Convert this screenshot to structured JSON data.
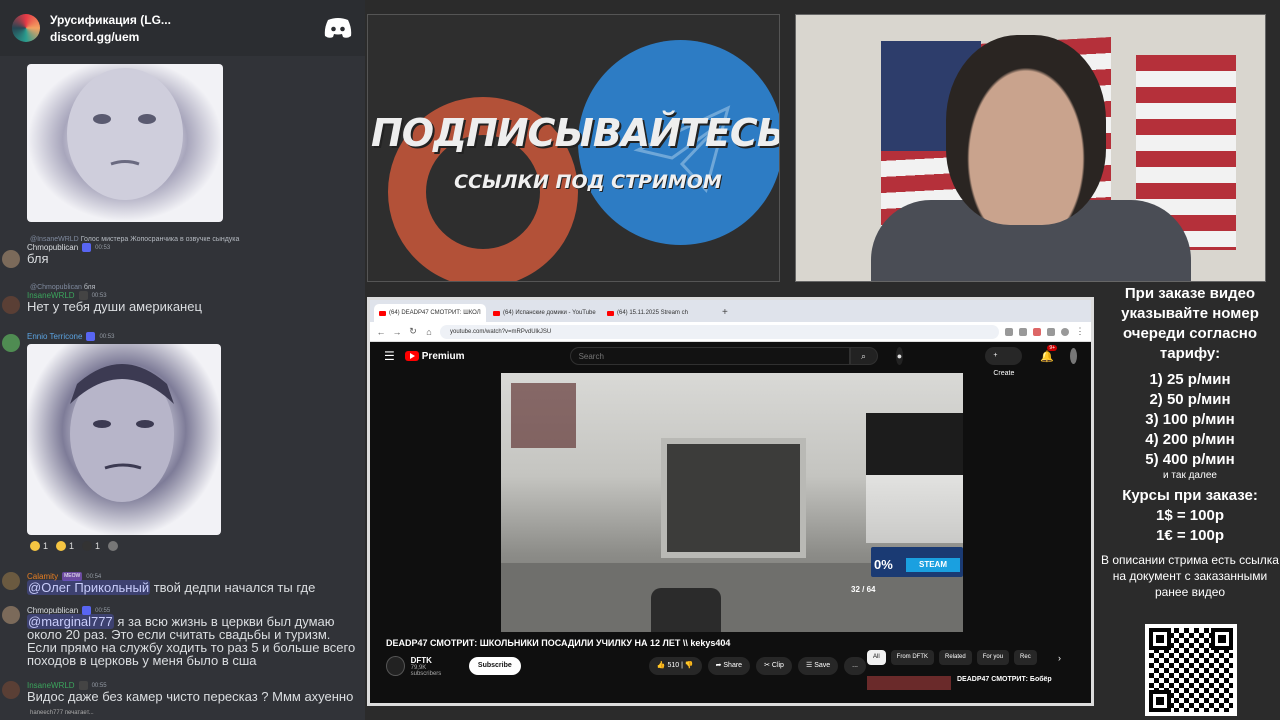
{
  "discord": {
    "server_name": "Урусификация (LG...",
    "invite": "discord.gg/uem",
    "reactions": [
      {
        "emoji": "face-icon",
        "count": "1"
      },
      {
        "emoji": "face-icon",
        "count": "1"
      },
      {
        "emoji": "face-icon",
        "count": "1"
      }
    ],
    "messages": [
      {
        "reply_to": "@InsaneWRLD",
        "reply_text": "Голос мистера Жопосранчика в озвучке сындука",
        "user": "Chmopublican",
        "user_color": "#dbdee1",
        "time": "00:53",
        "text": "бля"
      },
      {
        "reply_to": "@Chmopublican",
        "reply_text": "бля",
        "user": "InsaneWRLD",
        "user_color": "#3ba55c",
        "time": "00:53",
        "text": "Нет у тебя души американец"
      },
      {
        "user": "Ennio Terricone",
        "user_color": "#5ba3e0",
        "time": "00:53",
        "text": ""
      },
      {
        "user": "Calamity",
        "user_color": "#e67e22",
        "tag": "MEOW",
        "time": "00:54",
        "mention": "@Олег Прикольный",
        "text": " твой дедпи начался ты где"
      },
      {
        "user": "Chmopublican",
        "user_color": "#dbdee1",
        "time": "00:55",
        "mention": "@marginal777",
        "text": " я за всю жизнь в церкви был думаю около 20 раз. Это если считать свадьбы и туризм. Если прямо на службу ходить то раз 5 и больше всего походов в церковь у меня было в сша"
      },
      {
        "user": "InsaneWRLD",
        "user_color": "#3ba55c",
        "time": "00:55",
        "text": "Видос даже без камер чисто пересказ ? Ммм ахуенно"
      }
    ],
    "typing": "haneech777 печатает..."
  },
  "banner": {
    "title": "ПОДПИСЫВАЙТЕСЬ",
    "subtitle": "ССЫЛКИ ПОД СТРИМОМ"
  },
  "browser": {
    "tabs": [
      {
        "label": "(64) DEADP47 СМОТРИТ: ШКОЛ",
        "active": true
      },
      {
        "label": "(64) Испанские домики - YouTube",
        "active": false
      },
      {
        "label": "(64) 15.11.2025 Stream ch",
        "active": false
      }
    ],
    "new_tab": "+",
    "url": "youtube.com/watch?v=mRPvdUlkJSU"
  },
  "youtube": {
    "logo_label": "Premium",
    "search_placeholder": "Search",
    "create_label": "Create",
    "notifications": "9+",
    "video_title": "DEADP47 СМОТРИТ: ШКОЛЬНИКИ ПОСАДИЛИ УЧИЛКУ НА 12 ЛЕТ \\\\ kekys404",
    "channel": "DFTK",
    "subscribers": "79,9K subscribers",
    "subscribe_label": "Subscribe",
    "likes": "510",
    "share_label": "Share",
    "clip_label": "Clip",
    "save_label": "Save",
    "more_label": "...",
    "chips": [
      "All",
      "From DFTK",
      "Related",
      "For you",
      "Rec"
    ],
    "related_title": "DEADP47 СМОТРИТ: Бобёр",
    "player": {
      "promo_percent": "0%",
      "promo_store": "STEAM",
      "ammo": "32",
      "ammo_reserve": "64"
    }
  },
  "info": {
    "intro": "При заказе видео указывайте номер очереди согласно тарифу:",
    "tariffs": [
      "1) 25 р/мин",
      "2) 50 р/мин",
      "3) 100 р/мин",
      "4) 200 р/мин",
      "5) 400 р/мин"
    ],
    "tariffs_more": "и так далее",
    "rates_title": "Курсы при заказе:",
    "rates": [
      "1$ = 100р",
      "1€ = 100р"
    ],
    "description": "В описании стрима есть ссылка на документ с заказанными ранее видео"
  }
}
